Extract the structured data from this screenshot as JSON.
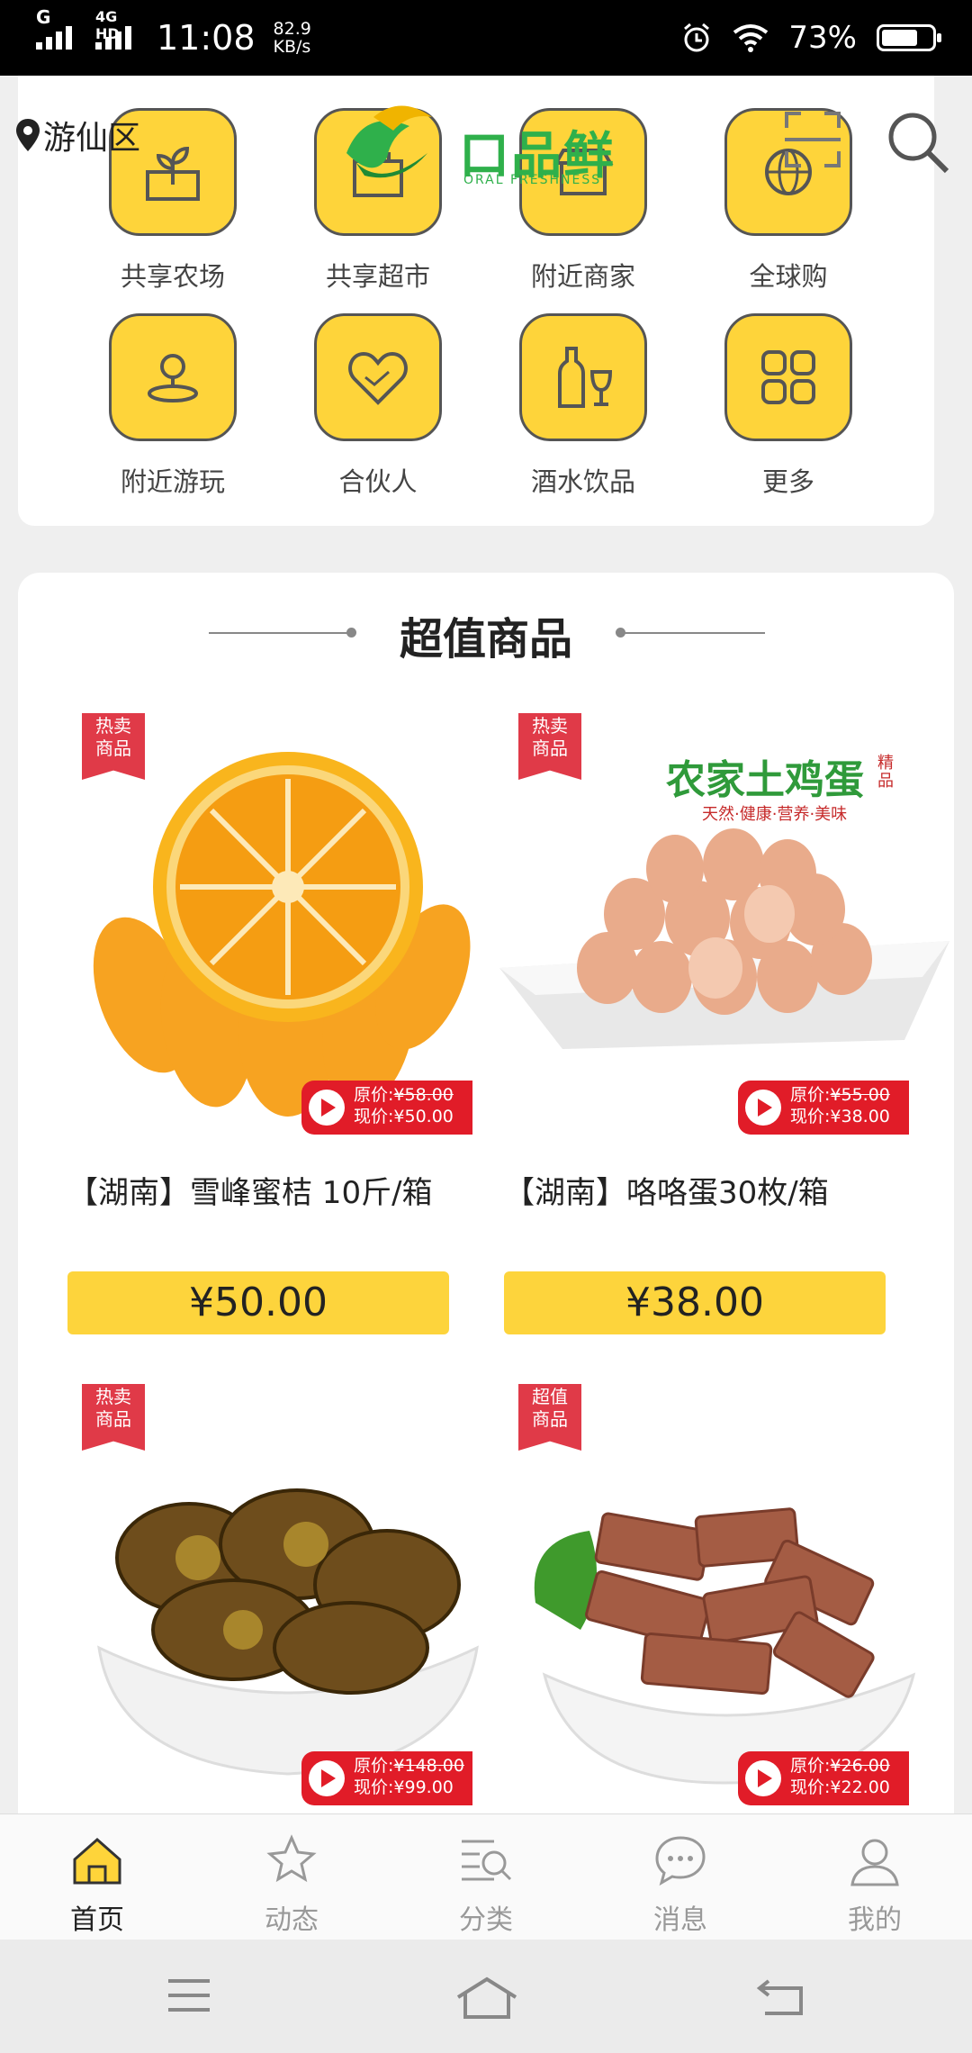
{
  "status_bar": {
    "network": "G",
    "network2": "4G HD",
    "time": "11:08",
    "speed_value": "82.9",
    "speed_unit": "KB/s",
    "battery": "73%",
    "battery_level": 0.73
  },
  "header": {
    "location": "游仙区",
    "logo_text": "口品鲜",
    "logo_sub": "ORAL FRESHNESS",
    "icons": [
      "scan-icon",
      "search-icon"
    ]
  },
  "categories": [
    {
      "label": "共享农场",
      "icon": "farm-sprout-icon"
    },
    {
      "label": "共享超市",
      "icon": "supermarket-icon"
    },
    {
      "label": "附近商家",
      "icon": "nearby-store-icon"
    },
    {
      "label": "全球购",
      "icon": "globe-icon"
    },
    {
      "label": "附近游玩",
      "icon": "location-person-icon"
    },
    {
      "label": "合伙人",
      "icon": "handshake-heart-icon"
    },
    {
      "label": "酒水饮品",
      "icon": "bottle-glass-icon"
    },
    {
      "label": "更多",
      "icon": "grid-more-icon"
    }
  ],
  "section": {
    "title": "超值商品"
  },
  "products": [
    {
      "badge": [
        "热卖",
        "商品"
      ],
      "orig_label": "原价:",
      "orig": "¥58.00",
      "now_label": "现价:",
      "now": "¥50.00",
      "name": "【湖南】雪峰蜜桔 10斤/箱",
      "price": "¥50.00"
    },
    {
      "badge": [
        "热卖",
        "商品"
      ],
      "orig_label": "原价:",
      "orig": "¥55.00",
      "now_label": "现价:",
      "now": "¥38.00",
      "name": "【湖南】咯咯蛋30枚/箱",
      "price": "¥38.00",
      "img_title": "农家土鸡蛋",
      "img_seal": "精品",
      "img_sub": "天然·健康·营养·美味"
    },
    {
      "badge": [
        "热卖",
        "商品"
      ],
      "orig_label": "原价:",
      "orig": "¥148.00",
      "now_label": "现价:",
      "now": "¥99.00"
    },
    {
      "badge": [
        "超值",
        "商品"
      ],
      "orig_label": "原价:",
      "orig": "¥26.00",
      "now_label": "现价:",
      "now": "¥22.00"
    }
  ],
  "tabs": [
    {
      "label": "首页",
      "icon": "home-icon",
      "active": true
    },
    {
      "label": "动态",
      "icon": "star-icon",
      "active": false
    },
    {
      "label": "分类",
      "icon": "category-search-icon",
      "active": false
    },
    {
      "label": "消息",
      "icon": "message-icon",
      "active": false
    },
    {
      "label": "我的",
      "icon": "user-icon",
      "active": false
    }
  ],
  "nav": [
    "menu-icon",
    "home-outline-icon",
    "back-icon"
  ],
  "colors": {
    "accent": "#fed43a",
    "red": "#e11c28",
    "brand_green": "#2fb04b"
  }
}
